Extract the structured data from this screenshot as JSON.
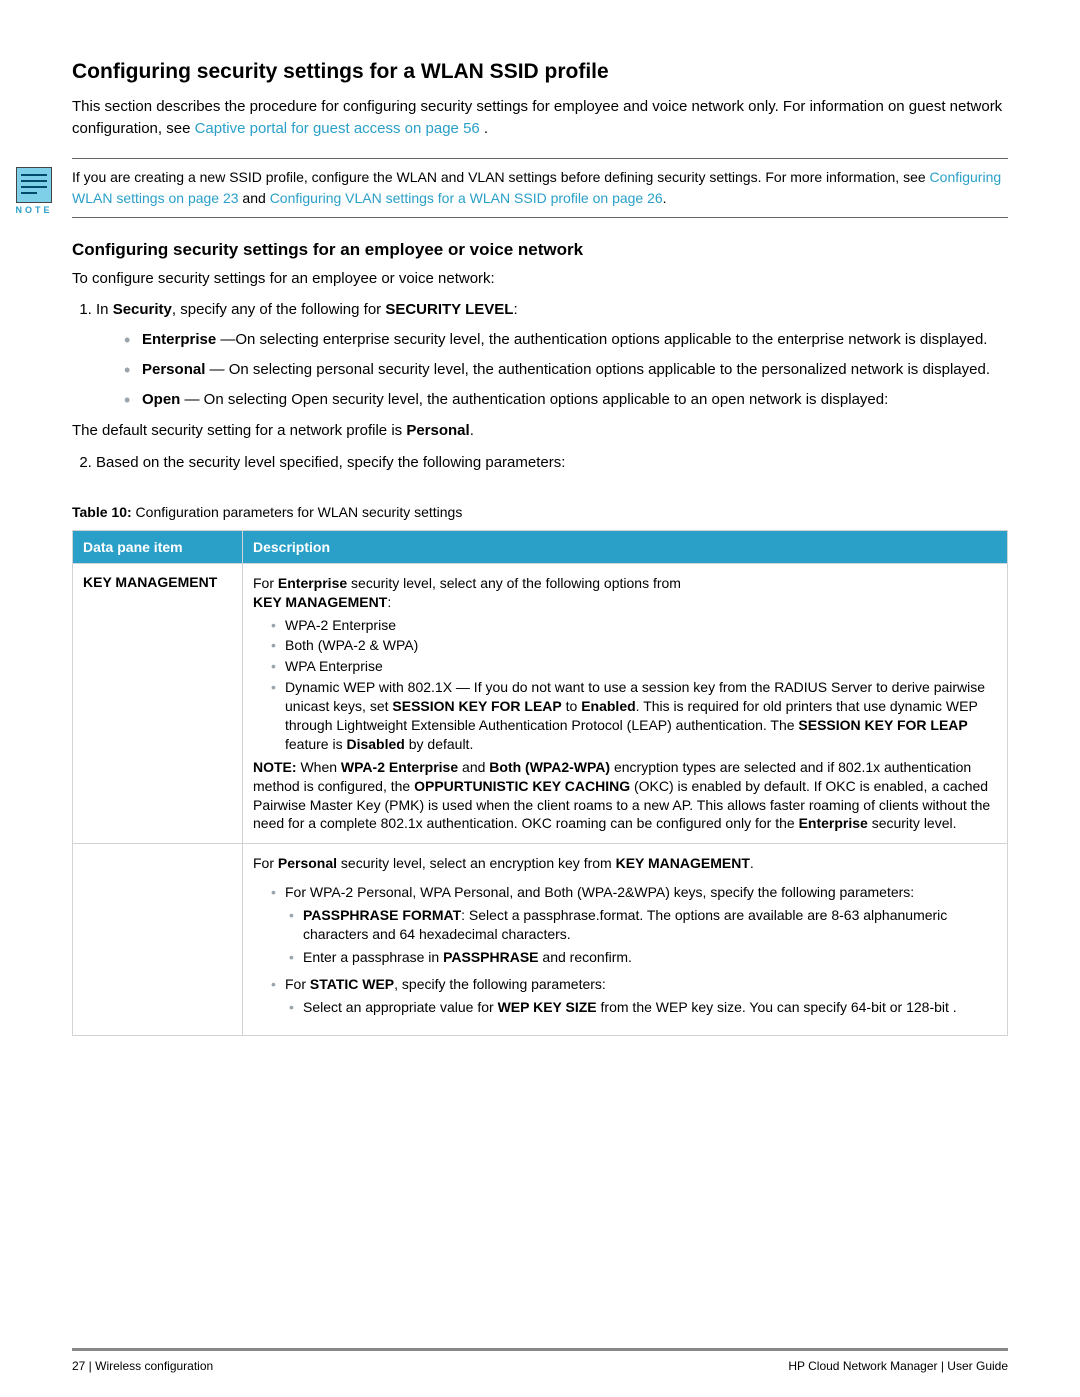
{
  "title": "Configuring security settings for a WLAN SSID profile",
  "intro_prefix": "This section describes the procedure for configuring security settings for employee and voice network only. For information on guest network configuration, see ",
  "intro_link": "Captive portal for guest access on page 56",
  "intro_suffix": " .",
  "note": {
    "label": "NOTE",
    "prefix": "If you are creating a new SSID profile, configure the WLAN and VLAN settings before defining security settings. For more information, see ",
    "link1": "Configuring WLAN settings on page 23",
    "mid": " and ",
    "link2": "Configuring VLAN settings for a WLAN SSID profile on page 26",
    "suffix": "."
  },
  "subsection_title": "Configuring security settings for an employee or voice network",
  "subsection_intro": "To configure security settings for an employee or voice network:",
  "step1_prefix": "In ",
  "step1_strong1": "Security",
  "step1_mid": ", specify any of the following for ",
  "step1_strong2": "SECURITY LEVEL",
  "step1_suffix": ":",
  "levels": {
    "enterprise_label": "Enterprise",
    "enterprise_desc": " —On selecting enterprise security level, the authentication options applicable to the enterprise network is displayed.",
    "personal_label": "Personal",
    "personal_desc": " — On selecting personal security level, the authentication options applicable to the personalized network is displayed.",
    "open_label": "Open",
    "open_desc": " — On selecting Open security level, the authentication options applicable to an open network is displayed:"
  },
  "default_line_prefix": "The default security setting for a network profile is ",
  "default_line_strong": "Personal",
  "default_line_suffix": ".",
  "step2": "Based on the security level specified, specify the following parameters:",
  "table_caption_prefix": "Table 10:",
  "table_caption_text": " Configuration parameters for WLAN security settings",
  "table": {
    "header_item": "Data pane item",
    "header_desc": "Description",
    "row1_key": "KEY MANAGEMENT",
    "row1": {
      "p1_a": "For ",
      "p1_b": "Enterprise",
      "p1_c": " security level, select any of the following options from ",
      "p1_d": "KEY MANAGEMENT",
      "p1_e": ":",
      "li1": "WPA-2 Enterprise",
      "li2": "Both (WPA-2 & WPA)",
      "li3": "WPA Enterprise",
      "li4_a": "Dynamic WEP with 802.1X — If you do not want to use a session key from the RADIUS Server to derive pairwise unicast keys, set ",
      "li4_b": "SESSION KEY FOR LEAP",
      "li4_c": " to ",
      "li4_d": "Enabled",
      "li4_e": ". This is required for old printers that use dynamic WEP through Lightweight Extensible Authentication Protocol (LEAP) authentication. The ",
      "li4_f": "SESSION KEY FOR LEAP",
      "li4_g": " feature is ",
      "li4_h": "Disabled",
      "li4_i": " by default.",
      "note_a": "NOTE:",
      "note_b": " When ",
      "note_c": "WPA-2 Enterprise",
      "note_d": " and ",
      "note_e": "Both (WPA2-WPA)",
      "note_f": " encryption types are selected and if 802.1x authentication method is configured, the ",
      "note_g": "OPPURTUNISTIC KEY CACHING",
      "note_h": " (OKC) is enabled by default. If OKC is enabled, a cached Pairwise Master Key (PMK) is used when the client roams to a new AP. This allows faster roaming of clients without the need for a complete 802.1x authentication. OKC roaming can be configured only for the ",
      "note_i": "Enterprise",
      "note_j": " security level."
    },
    "row2": {
      "p1_a": "For ",
      "p1_b": "Personal",
      "p1_c": " security level, select an encryption key from ",
      "p1_d": "KEY MANAGEMENT",
      "p1_e": ".",
      "li1": "For WPA-2 Personal, WPA Personal, and Both (WPA-2&WPA) keys, specify the following parameters:",
      "sub1_a": "PASSPHRASE FORMAT",
      "sub1_b": ": Select a passphrase.format. The options are available are 8-63 alphanumeric characters and 64 hexadecimal characters.",
      "sub2_a": "Enter a passphrase in ",
      "sub2_b": "PASSPHRASE",
      "sub2_c": " and reconfirm.",
      "li2_a": "For ",
      "li2_b": "STATIC WEP",
      "li2_c": ", specify the following parameters:",
      "sub3_a": "Select an appropriate value for ",
      "sub3_b": "WEP KEY SIZE",
      "sub3_c": " from the WEP key size. You can specify 64-bit or 128-bit ."
    }
  },
  "footer_left": "27 | Wireless configuration",
  "footer_right": "HP Cloud Network Manager | User Guide"
}
